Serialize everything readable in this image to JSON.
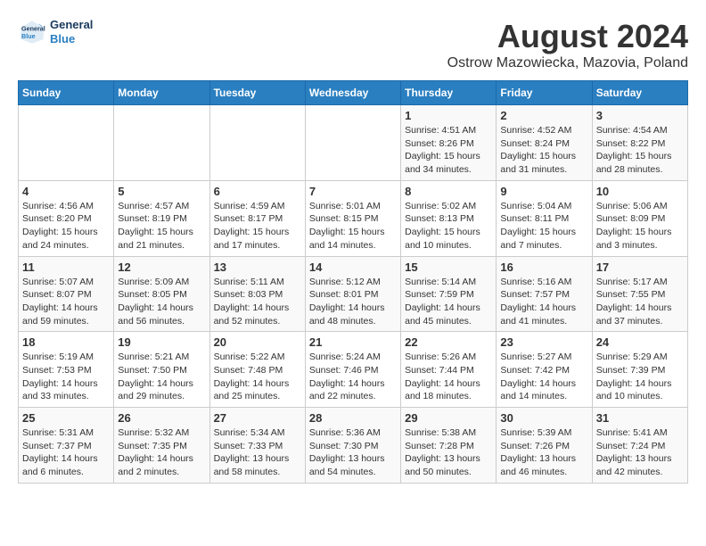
{
  "header": {
    "logo_line1": "General",
    "logo_line2": "Blue",
    "main_title": "August 2024",
    "subtitle": "Ostrow Mazowiecka, Mazovia, Poland"
  },
  "calendar": {
    "days_of_week": [
      "Sunday",
      "Monday",
      "Tuesday",
      "Wednesday",
      "Thursday",
      "Friday",
      "Saturday"
    ],
    "weeks": [
      [
        {
          "day": "",
          "info": ""
        },
        {
          "day": "",
          "info": ""
        },
        {
          "day": "",
          "info": ""
        },
        {
          "day": "",
          "info": ""
        },
        {
          "day": "1",
          "info": "Sunrise: 4:51 AM\nSunset: 8:26 PM\nDaylight: 15 hours\nand 34 minutes."
        },
        {
          "day": "2",
          "info": "Sunrise: 4:52 AM\nSunset: 8:24 PM\nDaylight: 15 hours\nand 31 minutes."
        },
        {
          "day": "3",
          "info": "Sunrise: 4:54 AM\nSunset: 8:22 PM\nDaylight: 15 hours\nand 28 minutes."
        }
      ],
      [
        {
          "day": "4",
          "info": "Sunrise: 4:56 AM\nSunset: 8:20 PM\nDaylight: 15 hours\nand 24 minutes."
        },
        {
          "day": "5",
          "info": "Sunrise: 4:57 AM\nSunset: 8:19 PM\nDaylight: 15 hours\nand 21 minutes."
        },
        {
          "day": "6",
          "info": "Sunrise: 4:59 AM\nSunset: 8:17 PM\nDaylight: 15 hours\nand 17 minutes."
        },
        {
          "day": "7",
          "info": "Sunrise: 5:01 AM\nSunset: 8:15 PM\nDaylight: 15 hours\nand 14 minutes."
        },
        {
          "day": "8",
          "info": "Sunrise: 5:02 AM\nSunset: 8:13 PM\nDaylight: 15 hours\nand 10 minutes."
        },
        {
          "day": "9",
          "info": "Sunrise: 5:04 AM\nSunset: 8:11 PM\nDaylight: 15 hours\nand 7 minutes."
        },
        {
          "day": "10",
          "info": "Sunrise: 5:06 AM\nSunset: 8:09 PM\nDaylight: 15 hours\nand 3 minutes."
        }
      ],
      [
        {
          "day": "11",
          "info": "Sunrise: 5:07 AM\nSunset: 8:07 PM\nDaylight: 14 hours\nand 59 minutes."
        },
        {
          "day": "12",
          "info": "Sunrise: 5:09 AM\nSunset: 8:05 PM\nDaylight: 14 hours\nand 56 minutes."
        },
        {
          "day": "13",
          "info": "Sunrise: 5:11 AM\nSunset: 8:03 PM\nDaylight: 14 hours\nand 52 minutes."
        },
        {
          "day": "14",
          "info": "Sunrise: 5:12 AM\nSunset: 8:01 PM\nDaylight: 14 hours\nand 48 minutes."
        },
        {
          "day": "15",
          "info": "Sunrise: 5:14 AM\nSunset: 7:59 PM\nDaylight: 14 hours\nand 45 minutes."
        },
        {
          "day": "16",
          "info": "Sunrise: 5:16 AM\nSunset: 7:57 PM\nDaylight: 14 hours\nand 41 minutes."
        },
        {
          "day": "17",
          "info": "Sunrise: 5:17 AM\nSunset: 7:55 PM\nDaylight: 14 hours\nand 37 minutes."
        }
      ],
      [
        {
          "day": "18",
          "info": "Sunrise: 5:19 AM\nSunset: 7:53 PM\nDaylight: 14 hours\nand 33 minutes."
        },
        {
          "day": "19",
          "info": "Sunrise: 5:21 AM\nSunset: 7:50 PM\nDaylight: 14 hours\nand 29 minutes."
        },
        {
          "day": "20",
          "info": "Sunrise: 5:22 AM\nSunset: 7:48 PM\nDaylight: 14 hours\nand 25 minutes."
        },
        {
          "day": "21",
          "info": "Sunrise: 5:24 AM\nSunset: 7:46 PM\nDaylight: 14 hours\nand 22 minutes."
        },
        {
          "day": "22",
          "info": "Sunrise: 5:26 AM\nSunset: 7:44 PM\nDaylight: 14 hours\nand 18 minutes."
        },
        {
          "day": "23",
          "info": "Sunrise: 5:27 AM\nSunset: 7:42 PM\nDaylight: 14 hours\nand 14 minutes."
        },
        {
          "day": "24",
          "info": "Sunrise: 5:29 AM\nSunset: 7:39 PM\nDaylight: 14 hours\nand 10 minutes."
        }
      ],
      [
        {
          "day": "25",
          "info": "Sunrise: 5:31 AM\nSunset: 7:37 PM\nDaylight: 14 hours\nand 6 minutes."
        },
        {
          "day": "26",
          "info": "Sunrise: 5:32 AM\nSunset: 7:35 PM\nDaylight: 14 hours\nand 2 minutes."
        },
        {
          "day": "27",
          "info": "Sunrise: 5:34 AM\nSunset: 7:33 PM\nDaylight: 13 hours\nand 58 minutes."
        },
        {
          "day": "28",
          "info": "Sunrise: 5:36 AM\nSunset: 7:30 PM\nDaylight: 13 hours\nand 54 minutes."
        },
        {
          "day": "29",
          "info": "Sunrise: 5:38 AM\nSunset: 7:28 PM\nDaylight: 13 hours\nand 50 minutes."
        },
        {
          "day": "30",
          "info": "Sunrise: 5:39 AM\nSunset: 7:26 PM\nDaylight: 13 hours\nand 46 minutes."
        },
        {
          "day": "31",
          "info": "Sunrise: 5:41 AM\nSunset: 7:24 PM\nDaylight: 13 hours\nand 42 minutes."
        }
      ]
    ]
  }
}
